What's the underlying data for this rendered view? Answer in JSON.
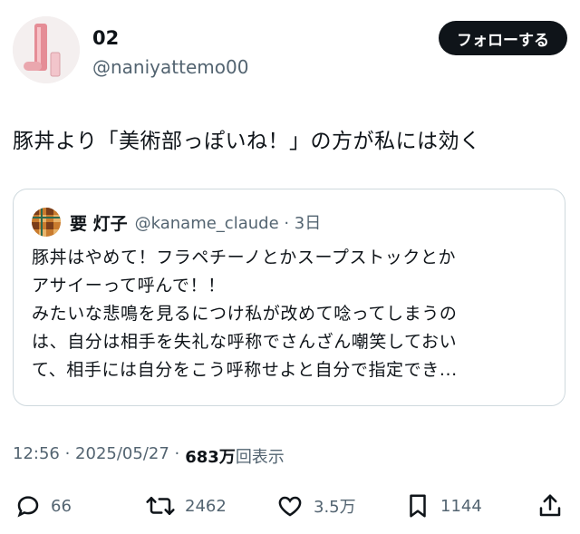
{
  "author": {
    "name": "02",
    "handle": "@naniyattemo00"
  },
  "follow_label": "フォローする",
  "tweet_text": "豚丼より「美術部っぽいね！」の方が私には効く",
  "quote": {
    "name": "要 灯子",
    "handle_time": "@kaname_claude · 3日",
    "text": "豚丼はやめて！フラペチーノとかスープストックとか\nアサイーって呼んで！！\nみたいな悲鳴を見るにつけ私が改めて唸ってしまうの\nは、自分は相手を失礼な呼称でさんざん嘲笑しておい\nて、相手には自分をこう呼称せよと自分で指定でき..."
  },
  "meta": {
    "time_date": "12:56 · 2025/05/27 ·",
    "views": "683万",
    "views_label": "回表示"
  },
  "actions": {
    "replies": "66",
    "retweets": "2462",
    "likes": "3.5万",
    "bookmarks": "1144"
  },
  "icons": [
    "reply-icon",
    "retweet-icon",
    "like-icon",
    "bookmark-icon",
    "share-icon"
  ]
}
